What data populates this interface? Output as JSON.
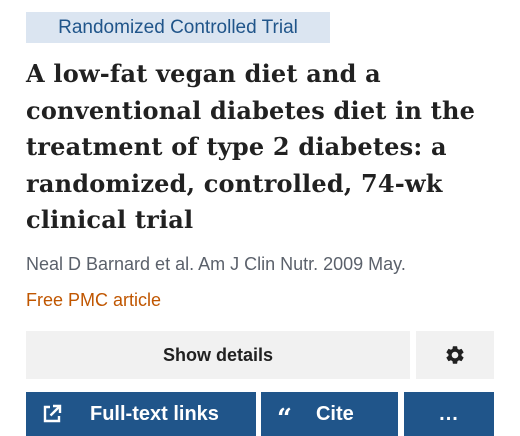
{
  "badge": {
    "label": "Randomized Controlled Trial"
  },
  "article": {
    "title": "A low-fat vegan diet and a conventional diabetes diet in the treatment of type 2 diabetes: a randomized, controlled, 74-wk clinical trial",
    "citation": "Neal D Barnard et al. Am J Clin Nutr. 2009 May.",
    "free_pmc": "Free PMC article"
  },
  "controls": {
    "show_details": "Show details",
    "settings_icon": "gear-icon"
  },
  "actions": {
    "full_text_links": "Full-text links",
    "full_text_icon": "external-link-icon",
    "cite": "Cite",
    "cite_icon": "quote-icon",
    "more": "..."
  },
  "colors": {
    "accent": "#20558a",
    "badge_bg": "#dbe5f1",
    "link_orange": "#c05600",
    "button_gray": "#f1f1f1"
  }
}
